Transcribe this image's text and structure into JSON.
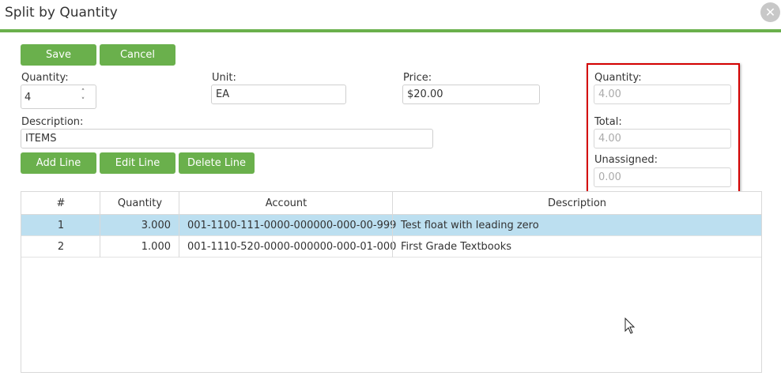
{
  "window": {
    "title": "Split by Quantity",
    "close_glyph": "✕"
  },
  "toolbar": {
    "save_label": "Save",
    "cancel_label": "Cancel"
  },
  "form": {
    "quantity_label": "Quantity:",
    "quantity_value": "4",
    "unit_label": "Unit:",
    "unit_value": "EA",
    "price_label": "Price:",
    "price_value": "$20.00",
    "description_label": "Description:",
    "description_value": "ITEMS"
  },
  "line_actions": {
    "add_label": "Add Line",
    "edit_label": "Edit Line",
    "delete_label": "Delete Line"
  },
  "summary": {
    "quantity_label": "Quantity:",
    "quantity_value": "4.00",
    "total_label": "Total:",
    "total_value": "4.00",
    "unassigned_label": "Unassigned:",
    "unassigned_value": "0.00",
    "highlight_color": "#d40000"
  },
  "grid": {
    "columns": [
      "#",
      "Quantity",
      "Account",
      "Description"
    ],
    "rows": [
      {
        "num": "1",
        "quantity": "3.000",
        "account": "001-1100-111-0000-000000-000-00-999",
        "description": "Test float with leading zero",
        "selected": true
      },
      {
        "num": "2",
        "quantity": "1.000",
        "account": "001-1110-520-0000-000000-000-01-000",
        "description": "First Grade Textbooks",
        "selected": false
      }
    ]
  },
  "colors": {
    "accent": "#6ab04c",
    "selected_row": "#bcdff0"
  },
  "icons": {
    "close": "close-icon",
    "spinner_up": "chevron-up-icon",
    "spinner_down": "chevron-down-icon",
    "cursor": "mouse-pointer-icon"
  }
}
